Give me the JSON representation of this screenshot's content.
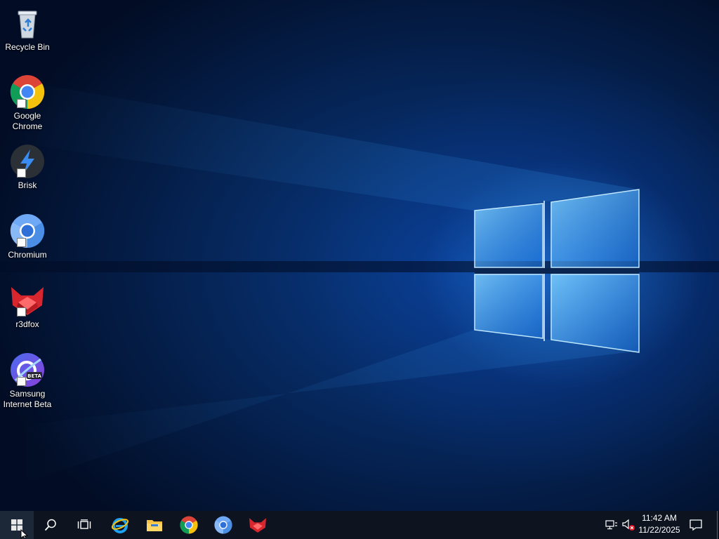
{
  "desktop": {
    "icons": [
      {
        "label": "Recycle Bin",
        "icon": "recycle-bin-icon"
      },
      {
        "label": "Google Chrome",
        "icon": "chrome-icon"
      },
      {
        "label": "Brisk",
        "icon": "brisk-icon"
      },
      {
        "label": "Chromium",
        "icon": "chromium-icon"
      },
      {
        "label": "r3dfox",
        "icon": "r3dfox-icon"
      },
      {
        "label": "Samsung Internet Beta",
        "icon": "samsung-internet-beta-icon",
        "badge": "BETA"
      }
    ]
  },
  "taskbar": {
    "pinned": [
      "start-icon",
      "search-icon",
      "task-view-icon",
      "internet-explorer-icon",
      "file-explorer-icon",
      "chrome-icon",
      "chromium-icon",
      "r3dfox-icon"
    ],
    "tray": {
      "time": "11:42 AM",
      "date": "11/22/2025",
      "icons": [
        "network-icon",
        "volume-muted-icon",
        "notifications-icon"
      ]
    }
  },
  "colors": {
    "taskbar_bg": "#0d1420",
    "wallpaper_blue": "#1e8cff",
    "chrome_red": "#db4437",
    "chrome_yellow": "#f4c20d",
    "chrome_green": "#0f9d58",
    "chrome_blue": "#4285f4"
  }
}
